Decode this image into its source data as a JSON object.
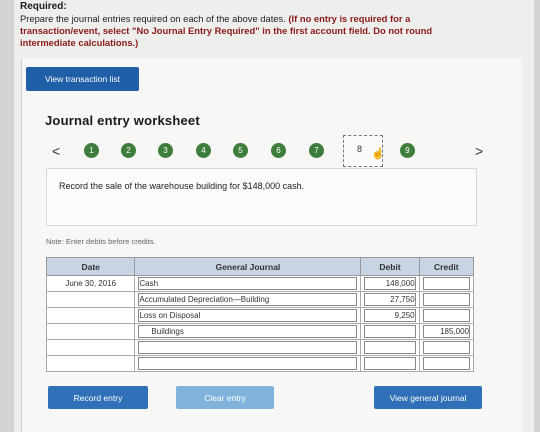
{
  "required": {
    "title": "Required:",
    "text_plain": "Prepare the journal entries required on each of the above dates. ",
    "text_bold": "(If no entry is required for a transaction/event, select \"No Journal Entry Required\" in the first account field. Do not round intermediate calculations.)"
  },
  "buttons": {
    "view_transactions": "View transaction list",
    "record_entry": "Record entry",
    "clear_entry": "Clear entry",
    "view_general_journal": "View general journal"
  },
  "worksheet": {
    "title": "Journal entry worksheet",
    "prev_arrow": "<",
    "next_arrow": ">",
    "steps": [
      "1",
      "2",
      "3",
      "4",
      "5",
      "6",
      "7",
      "8",
      "9"
    ],
    "current_step": "8",
    "instruction": "Record the sale of the warehouse building for $148,000 cash.",
    "note": "Note: Enter debits before credits."
  },
  "journal": {
    "headers": {
      "date": "Date",
      "general_journal": "General Journal",
      "debit": "Debit",
      "credit": "Credit"
    },
    "rows": [
      {
        "date": "June 30, 2016",
        "account": "Cash",
        "debit": "148,000",
        "credit": ""
      },
      {
        "date": "",
        "account": "Accumulated Depreciation—Building",
        "debit": "27,750",
        "credit": ""
      },
      {
        "date": "",
        "account": "Loss on Disposal",
        "debit": "9,250",
        "credit": ""
      },
      {
        "date": "",
        "account": "Buildings",
        "debit": "",
        "credit": "185,000"
      },
      {
        "date": "",
        "account": "",
        "debit": "",
        "credit": ""
      },
      {
        "date": "",
        "account": "",
        "debit": "",
        "credit": ""
      }
    ]
  },
  "colors": {
    "step_green": "#3e7d3c",
    "primary_button": "#2f70b8",
    "clear_button": "#7fb3dc",
    "table_header": "#c8d4e4"
  }
}
